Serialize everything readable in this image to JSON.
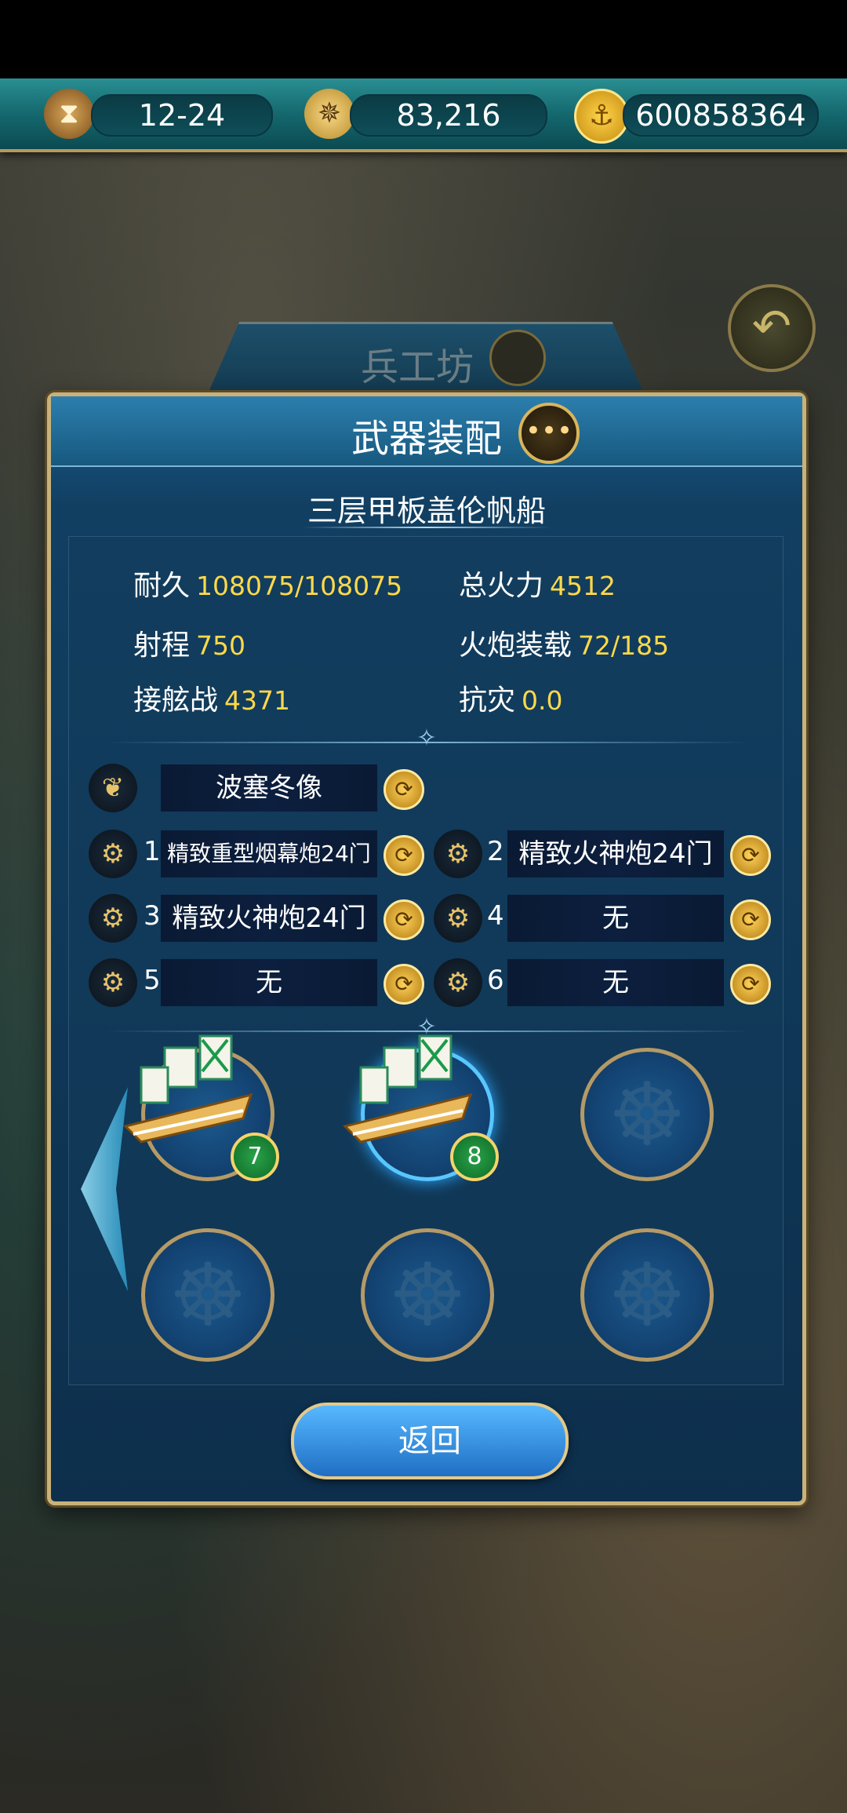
{
  "resources": {
    "date": "12-24",
    "compass_value": "83,216",
    "gold": "600858364"
  },
  "background_tab": {
    "title": "兵工坊"
  },
  "panel": {
    "title": "武器装配",
    "ship_name": "三层甲板盖伦帆船"
  },
  "stats": {
    "durability_label": "耐久",
    "durability_value": "108075/108075",
    "firepower_label": "总火力",
    "firepower_value": "4512",
    "range_label": "射程",
    "range_value": "750",
    "cannon_load_label": "火炮装载",
    "cannon_load_value": "72/185",
    "boarding_label": "接舷战",
    "boarding_value": "4371",
    "disaster_resist_label": "抗灾",
    "disaster_resist_value": "0.0"
  },
  "figurehead": {
    "name": "波塞冬像"
  },
  "cannon_slots": [
    {
      "number": "1",
      "name": "精致重型烟幕炮24门"
    },
    {
      "number": "2",
      "name": "精致火神炮24门"
    },
    {
      "number": "3",
      "name": "精致火神炮24门"
    },
    {
      "number": "4",
      "name": "无"
    },
    {
      "number": "5",
      "name": "无"
    },
    {
      "number": "6",
      "name": "无"
    }
  ],
  "fleet": [
    {
      "level": "7"
    },
    {
      "level": "8"
    }
  ],
  "buttons": {
    "return_label": "返回"
  },
  "colors": {
    "accent_gold": "#ffd94a",
    "panel_blue": "#113f62",
    "frame_gold": "#c9b27a"
  },
  "icons": {
    "hourglass": "hourglass-icon",
    "compass": "compass-icon",
    "coin": "anchor-coin-icon",
    "back": "back-arrow-icon",
    "chat": "chat-bubble-icon",
    "wing": "wing-icon",
    "cannon": "cannon-icon",
    "swap": "swap-icon",
    "wheel": "ship-wheel-icon"
  }
}
